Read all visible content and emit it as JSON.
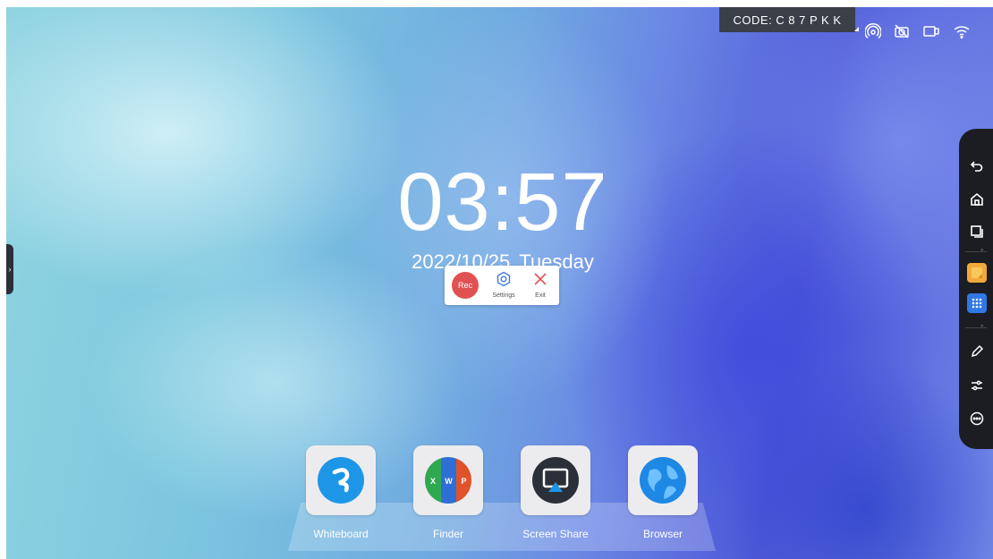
{
  "status_bar": {
    "code_label": "CODE: C 8 7 P K K",
    "icons": [
      "hotspot-icon",
      "camera-off-icon",
      "screen-mirror-icon",
      "wifi-icon"
    ]
  },
  "clock": {
    "time": "03:57",
    "date": "2022/10/25",
    "weekday": "Tuesday"
  },
  "recorder_popup": {
    "rec_label": "Rec",
    "settings_label": "Settings",
    "exit_label": "Exit",
    "rec_color": "#e05252"
  },
  "sidebar": {
    "icons": [
      "back-icon",
      "home-icon",
      "recent-apps-icon",
      "notes-app-icon",
      "apps-grid-icon",
      "pen-icon",
      "sliders-icon",
      "more-icon"
    ]
  },
  "dock": {
    "apps": [
      {
        "label": "Whiteboard",
        "icon": "whiteboard-icon"
      },
      {
        "label": "Finder",
        "icon": "finder-icon"
      },
      {
        "label": "Screen Share",
        "icon": "screen-share-icon"
      },
      {
        "label": "Browser",
        "icon": "browser-icon"
      }
    ]
  }
}
